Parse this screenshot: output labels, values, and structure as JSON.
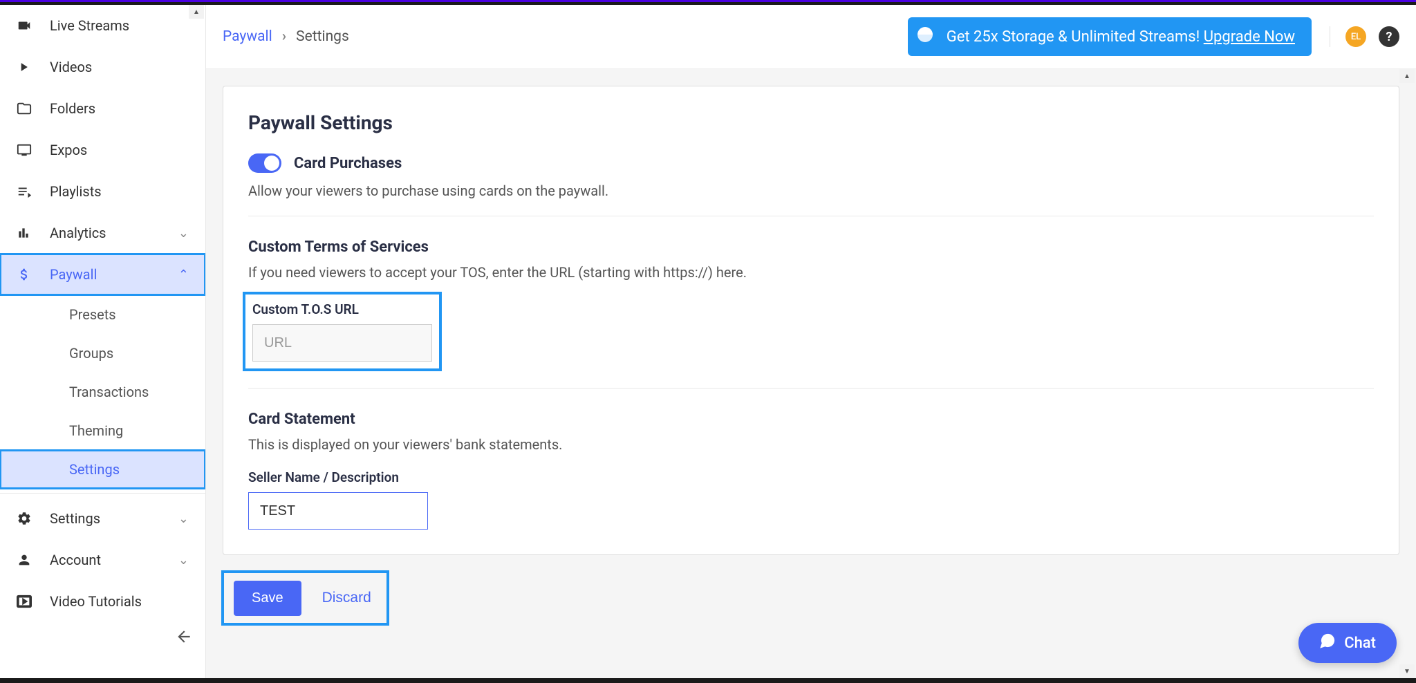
{
  "sidebar": {
    "main_items": [
      {
        "id": "livestreams",
        "label": "Live Streams"
      },
      {
        "id": "videos",
        "label": "Videos"
      },
      {
        "id": "folders",
        "label": "Folders"
      },
      {
        "id": "expos",
        "label": "Expos"
      },
      {
        "id": "playlists",
        "label": "Playlists"
      },
      {
        "id": "analytics",
        "label": "Analytics",
        "expandable": true
      },
      {
        "id": "paywall",
        "label": "Paywall",
        "expandable": true,
        "active": true
      }
    ],
    "paywall_sub": [
      {
        "id": "presets",
        "label": "Presets"
      },
      {
        "id": "groups",
        "label": "Groups"
      },
      {
        "id": "transactions",
        "label": "Transactions"
      },
      {
        "id": "theming",
        "label": "Theming"
      },
      {
        "id": "settings",
        "label": "Settings",
        "active": true
      }
    ],
    "bottom_items": [
      {
        "id": "settings",
        "label": "Settings",
        "expandable": true
      },
      {
        "id": "account",
        "label": "Account",
        "expandable": true
      },
      {
        "id": "tutorials",
        "label": "Video Tutorials"
      }
    ]
  },
  "breadcrumb": {
    "parent": "Paywall",
    "current": "Settings"
  },
  "promo": {
    "text": "Get 25x Storage & Unlimited Streams! ",
    "cta": "Upgrade Now"
  },
  "user": {
    "initials": "EL"
  },
  "page": {
    "title": "Paywall Settings",
    "card_purchases": {
      "label": "Card Purchases",
      "desc": "Allow your viewers to purchase using cards on the paywall."
    },
    "tos": {
      "title": "Custom Terms of Services",
      "desc": "If you need viewers to accept your TOS, enter the URL (starting with https://) here.",
      "field_label": "Custom T.O.S URL",
      "placeholder": "URL",
      "value": ""
    },
    "card_statement": {
      "title": "Card Statement",
      "desc": "This is displayed on your viewers' bank statements.",
      "field_label": "Seller Name / Description",
      "value": "TEST"
    },
    "actions": {
      "save": "Save",
      "discard": "Discard"
    }
  },
  "chat": {
    "label": "Chat"
  }
}
